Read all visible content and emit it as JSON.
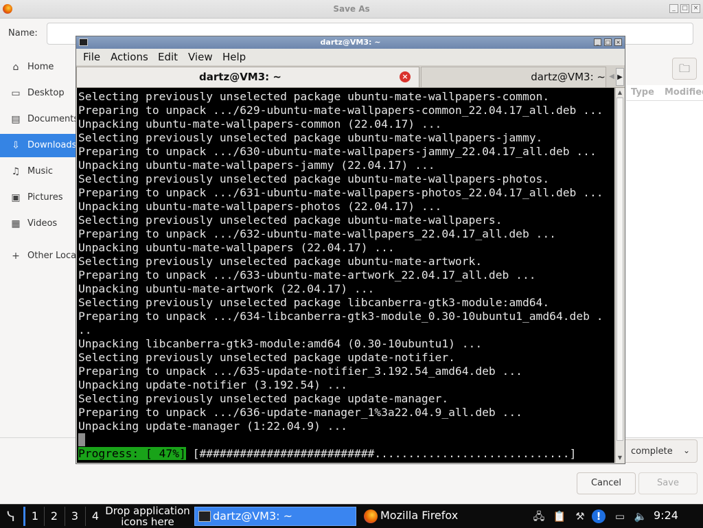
{
  "save_dialog": {
    "title": "Save As",
    "name_label": "Name:",
    "name_value": "",
    "sidebar": [
      {
        "label": "Home",
        "icon": "home-icon"
      },
      {
        "label": "Desktop",
        "icon": "desktop-icon"
      },
      {
        "label": "Documents",
        "icon": "documents-icon"
      },
      {
        "label": "Downloads",
        "icon": "downloads-icon",
        "selected": true
      },
      {
        "label": "Music",
        "icon": "music-icon"
      },
      {
        "label": "Pictures",
        "icon": "pictures-icon"
      },
      {
        "label": "Videos",
        "icon": "videos-icon"
      },
      {
        "label": "Other Locations",
        "icon": "plus-icon"
      }
    ],
    "columns": [
      "Type",
      "Modified"
    ],
    "filter_value": "complete",
    "cancel_label": "Cancel",
    "save_label": "Save",
    "accent_color": "#3584e4"
  },
  "terminal": {
    "title": "dartz@VM3: ~",
    "menu": [
      "File",
      "Actions",
      "Edit",
      "View",
      "Help"
    ],
    "tabs": [
      {
        "label": "dartz@VM3: ~",
        "active": true
      },
      {
        "label": "dartz@VM3: ~",
        "active": false
      }
    ],
    "lines": [
      "Selecting previously unselected package ubuntu-mate-wallpapers-common.",
      "Preparing to unpack .../629-ubuntu-mate-wallpapers-common_22.04.17_all.deb ...",
      "Unpacking ubuntu-mate-wallpapers-common (22.04.17) ...",
      "Selecting previously unselected package ubuntu-mate-wallpapers-jammy.",
      "Preparing to unpack .../630-ubuntu-mate-wallpapers-jammy_22.04.17_all.deb ...",
      "Unpacking ubuntu-mate-wallpapers-jammy (22.04.17) ...",
      "Selecting previously unselected package ubuntu-mate-wallpapers-photos.",
      "Preparing to unpack .../631-ubuntu-mate-wallpapers-photos_22.04.17_all.deb ...",
      "Unpacking ubuntu-mate-wallpapers-photos (22.04.17) ...",
      "Selecting previously unselected package ubuntu-mate-wallpapers.",
      "Preparing to unpack .../632-ubuntu-mate-wallpapers_22.04.17_all.deb ...",
      "Unpacking ubuntu-mate-wallpapers (22.04.17) ...",
      "Selecting previously unselected package ubuntu-mate-artwork.",
      "Preparing to unpack .../633-ubuntu-mate-artwork_22.04.17_all.deb ...",
      "Unpacking ubuntu-mate-artwork (22.04.17) ...",
      "Selecting previously unselected package libcanberra-gtk3-module:amd64.",
      "Preparing to unpack .../634-libcanberra-gtk3-module_0.30-10ubuntu1_amd64.deb .",
      "..",
      "Unpacking libcanberra-gtk3-module:amd64 (0.30-10ubuntu1) ...",
      "Selecting previously unselected package update-notifier.",
      "Preparing to unpack .../635-update-notifier_3.192.54_amd64.deb ...",
      "Unpacking update-notifier (3.192.54) ...",
      "Selecting previously unselected package update-manager.",
      "Preparing to unpack .../636-update-manager_1%3a22.04.9_all.deb ...",
      "Unpacking update-manager (1:22.04.9) ..."
    ],
    "progress_label": "Progress: [ 47%]",
    "progress_bar": "[##########################.............................]",
    "progress_percent": 47,
    "progress_color": "#19a319"
  },
  "taskbar": {
    "workspaces": [
      "1",
      "2",
      "3",
      "4"
    ],
    "drop_hint": "Drop application icons here",
    "tasks": [
      {
        "label": "dartz@VM3: ~",
        "icon": "terminal-icon",
        "active": true
      },
      {
        "label": "Mozilla Firefox",
        "icon": "firefox-icon",
        "active": false
      }
    ],
    "tray_icons": [
      "network-icon",
      "clipboard-icon",
      "tools-icon",
      "update-alert-icon",
      "notes-icon",
      "volume-icon"
    ],
    "clock": "9:24",
    "highlight_color": "#3a85f0"
  }
}
